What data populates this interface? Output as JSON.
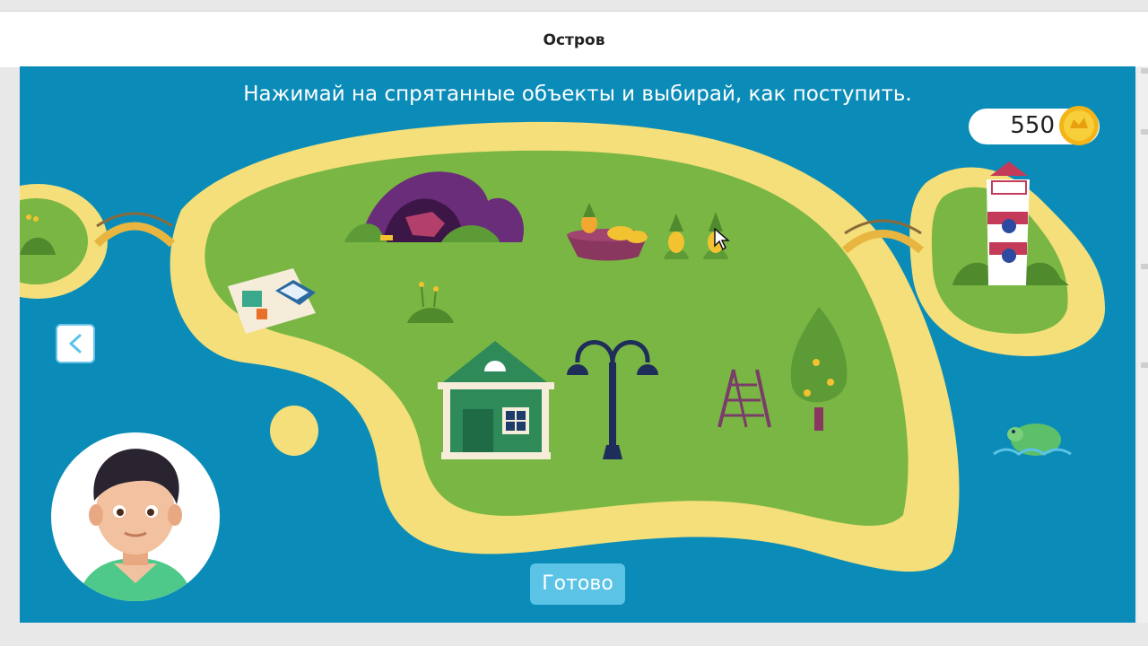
{
  "window": {
    "title": "Остров"
  },
  "game": {
    "instruction": "Нажимай на спрятанные объекты и выбирай, как поступить.",
    "coins": "550",
    "done_label": "Готово"
  },
  "colors": {
    "water": "#0b8cb8",
    "sand": "#f4df7a",
    "grass": "#7ab643",
    "button": "#5bc3e6"
  },
  "icons": [
    "chevron-left-icon",
    "coin-icon",
    "cursor-icon"
  ]
}
